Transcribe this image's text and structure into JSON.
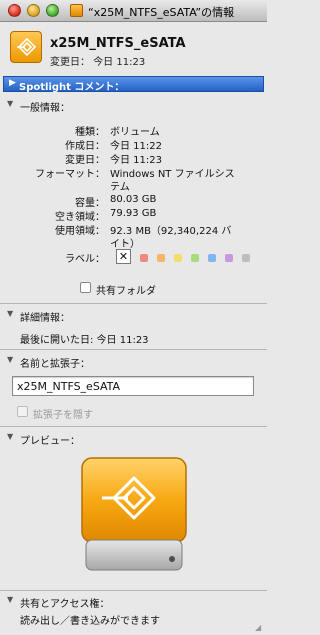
{
  "window": {
    "title": "“x25M_NTFS_eSATA”の情報"
  },
  "header": {
    "name": "x25M_NTFS_eSATA",
    "modified": "変更日： 今日 11:23"
  },
  "spotlight": {
    "label": "Spotlight コメント："
  },
  "general": {
    "title": "一般情報：",
    "rows": [
      {
        "label": "種類：",
        "value": "ボリューム"
      },
      {
        "label": "作成日：",
        "value": "今日 11:22"
      },
      {
        "label": "変更日：",
        "value": "今日 11:23"
      },
      {
        "label": "フォーマット：",
        "value": "Windows NT ファイルシス"
      },
      {
        "label": "",
        "value": "テム"
      },
      {
        "label": "容量：",
        "value": "80.03 GB"
      },
      {
        "label": "空き領域：",
        "value": "79.93 GB"
      },
      {
        "label": "使用領域：",
        "value": "92.3 MB（92,340,224 バ"
      },
      {
        "label": "",
        "value": "イト）"
      }
    ],
    "label_title": "ラベル：",
    "label_none": "✕",
    "label_colors": [
      "#f08a7e",
      "#f6b56a",
      "#f3de6c",
      "#a9db7d",
      "#80b7ef",
      "#c99ae0",
      "#bdbdbd"
    ],
    "shared_folder": "共有フォルダ"
  },
  "more_info": {
    "title": "詳細情報：",
    "last_opened": "最後に開いた日: 今日 11:23"
  },
  "name_ext": {
    "title": "名前と拡張子：",
    "value": "x25M_NTFS_eSATA",
    "hide_ext": "拡張子を隠す"
  },
  "preview": {
    "title": "プレビュー："
  },
  "sharing": {
    "title": "共有とアクセス権：",
    "status": "読み出し／書き込みができます"
  }
}
